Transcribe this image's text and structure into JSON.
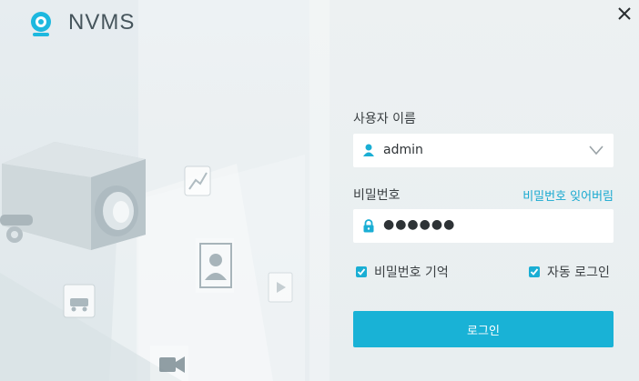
{
  "app": {
    "title": "NVMS"
  },
  "login": {
    "username_label": "사용자 이름",
    "username_value": "admin",
    "password_label": "비밀번호",
    "forgot_password": "비밀번호 잊어버림",
    "password_value": "●●●●●●",
    "remember_password": "비밀번호 기억",
    "remember_password_checked": true,
    "auto_login": "자동 로그인",
    "auto_login_checked": true,
    "login_button": "로그인"
  },
  "colors": {
    "accent": "#19b2d6",
    "link": "#18a9d0",
    "logo": "#1db8df",
    "background": "#e9eef0"
  },
  "icons": {
    "logo": "webcam-icon",
    "close": "close-icon",
    "user": "user-icon",
    "lock": "lock-icon",
    "dropdown": "chevron-down-icon"
  }
}
